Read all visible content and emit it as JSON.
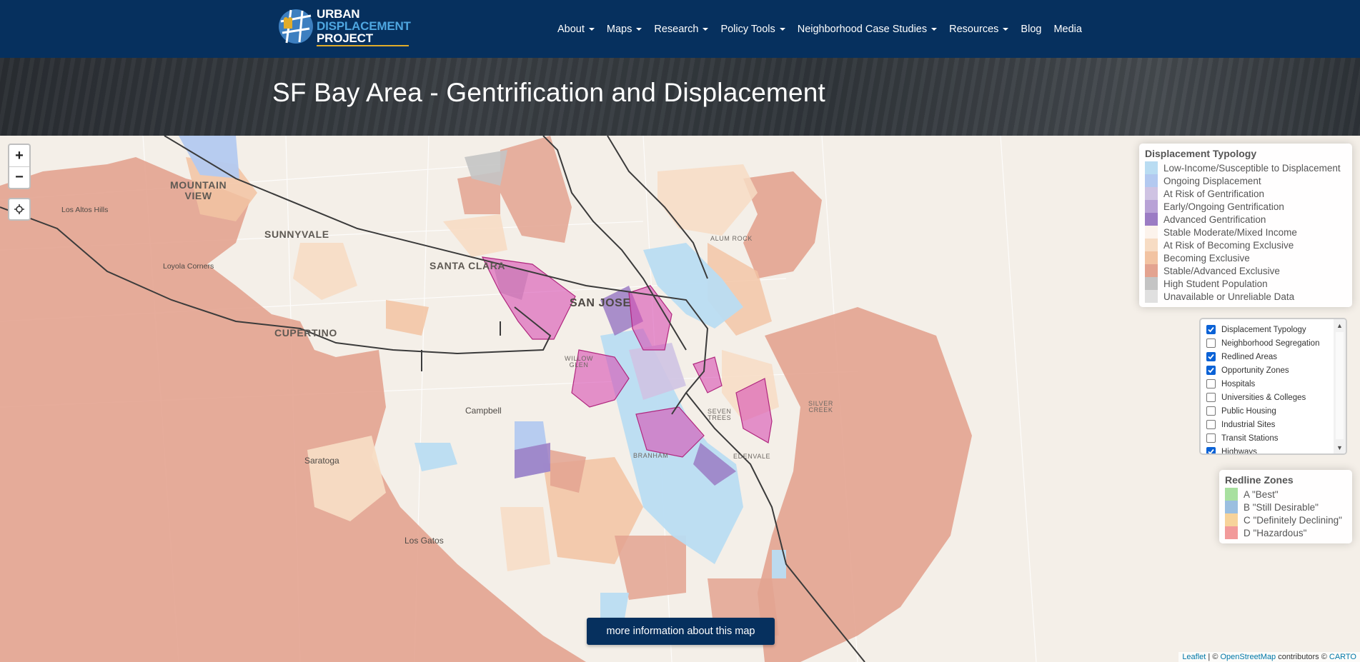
{
  "logo": {
    "line1": "URBAN",
    "line2": "DISPLACEMENT",
    "line3": "PROJECT"
  },
  "nav": [
    {
      "label": "About",
      "dropdown": true
    },
    {
      "label": "Maps",
      "dropdown": true
    },
    {
      "label": "Research",
      "dropdown": true
    },
    {
      "label": "Policy Tools",
      "dropdown": true
    },
    {
      "label": "Neighborhood Case Studies",
      "dropdown": true
    },
    {
      "label": "Resources",
      "dropdown": true
    },
    {
      "label": "Blog",
      "dropdown": false
    },
    {
      "label": "Media",
      "dropdown": false
    }
  ],
  "page_title": "SF Bay Area - Gentrification and Displacement",
  "map": {
    "labels": {
      "mountain_view_1": "MOUNTAIN",
      "mountain_view_2": "VIEW",
      "los_altos_hills": "Los Altos Hills",
      "sunnyvale": "SUNNYVALE",
      "loyola_corners": "Loyola Corners",
      "santa_clara": "SANTA CLARA",
      "san_jose": "SAN JOSE",
      "alum_rock": "ALUM ROCK",
      "cupertino": "CUPERTINO",
      "willow_glen_1": "WILLOW",
      "willow_glen_2": "GLEN",
      "campbell": "Campbell",
      "seven_trees_1": "SEVEN",
      "seven_trees_2": "TREES",
      "silver_creek_1": "SILVER",
      "silver_creek_2": "CREEK",
      "branham": "BRANHAM",
      "edenvale": "EDENVALE",
      "saratoga": "Saratoga",
      "los_gatos": "Los Gatos"
    },
    "zoom_in": "+",
    "zoom_out": "−",
    "locate_icon": "crosshair-icon"
  },
  "displacement_legend": {
    "title": "Displacement Typology",
    "items": [
      {
        "label": "Low-Income/Susceptible to Displacement",
        "color": "#b9dcf2"
      },
      {
        "label": "Ongoing Displacement",
        "color": "#b3c9f0"
      },
      {
        "label": "At Risk of Gentrification",
        "color": "#cfc3e3"
      },
      {
        "label": "Early/Ongoing Gentrification",
        "color": "#b8a2d6"
      },
      {
        "label": "Advanced Gentrification",
        "color": "#9b7cc4"
      },
      {
        "label": "Stable Moderate/Mixed Income",
        "color": "#fcf3ec"
      },
      {
        "label": "At Risk of Becoming Exclusive",
        "color": "#f7dcc4"
      },
      {
        "label": "Becoming Exclusive",
        "color": "#f2c3a2"
      },
      {
        "label": "Stable/Advanced Exclusive",
        "color": "#e3a390"
      },
      {
        "label": "High Student Population",
        "color": "#c4c4c4"
      },
      {
        "label": "Unavailable or Unreliable Data",
        "color": "#e0e0e0"
      }
    ]
  },
  "layers": [
    {
      "label": "Displacement Typology",
      "checked": true
    },
    {
      "label": "Neighborhood Segregation",
      "checked": false
    },
    {
      "label": "Redlined Areas",
      "checked": true
    },
    {
      "label": "Opportunity Zones",
      "checked": true
    },
    {
      "label": "Hospitals",
      "checked": false
    },
    {
      "label": "Universities & Colleges",
      "checked": false
    },
    {
      "label": "Public Housing",
      "checked": false
    },
    {
      "label": "Industrial Sites",
      "checked": false
    },
    {
      "label": "Transit Stations",
      "checked": false
    },
    {
      "label": "Highways",
      "checked": true
    }
  ],
  "redline_legend": {
    "title": "Redline Zones",
    "items": [
      {
        "label": "A \"Best\"",
        "color": "#a8e0a0"
      },
      {
        "label": "B \"Still Desirable\"",
        "color": "#9bbfe0"
      },
      {
        "label": "C \"Definitely Declining\"",
        "color": "#f7d39a"
      },
      {
        "label": "D \"Hazardous\"",
        "color": "#f29a9a"
      }
    ]
  },
  "more_info_button": "more information about this map",
  "attribution": {
    "leaflet": "Leaflet",
    "sep1": " | © ",
    "osm": "OpenStreetMap",
    "contrib": " contributors © ",
    "carto": "CARTO"
  }
}
